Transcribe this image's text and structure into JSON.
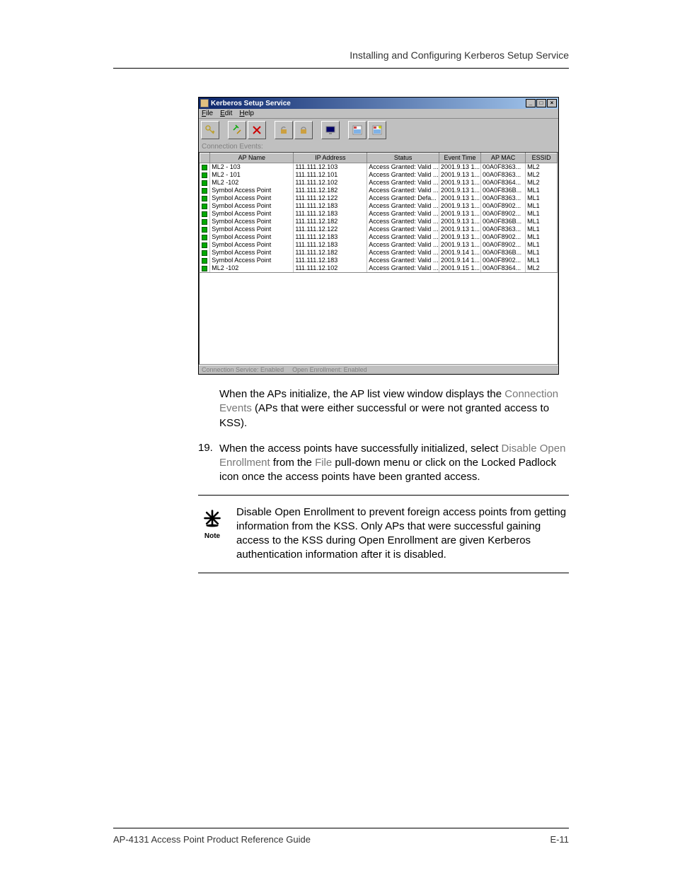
{
  "header": {
    "title": "Installing and Configuring Kerberos Setup Service"
  },
  "window": {
    "title": "Kerberos Setup Service",
    "menus": [
      "File",
      "Edit",
      "Help"
    ],
    "section_label": "Connection Events:",
    "columns": [
      "",
      "AP Name",
      "IP Address",
      "Status",
      "Event Time",
      "AP MAC",
      "ESSID"
    ],
    "rows": [
      {
        "ap": "ML2 - 103",
        "ip": "111.111.12.103",
        "status": "Access Granted: Valid ...",
        "time": "2001.9.13 1...",
        "mac": "00A0F8363...",
        "essid": "ML2"
      },
      {
        "ap": "ML2 - 101",
        "ip": "111.111.12.101",
        "status": "Access Granted: Valid ...",
        "time": "2001.9.13 1...",
        "mac": "00A0F8363...",
        "essid": "ML2"
      },
      {
        "ap": "ML2 -102",
        "ip": "111.111.12.102",
        "status": "Access Granted: Valid ...",
        "time": "2001.9.13 1...",
        "mac": "00A0F8364...",
        "essid": "ML2"
      },
      {
        "ap": "Symbol Access Point",
        "ip": "111.111.12.182",
        "status": "Access Granted: Valid ...",
        "time": "2001.9.13 1...",
        "mac": "00A0F836B...",
        "essid": "ML1"
      },
      {
        "ap": "Symbol Access Point",
        "ip": "111.111.12.122",
        "status": "Access Granted: Defa...",
        "time": "2001.9.13 1...",
        "mac": "00A0F8363...",
        "essid": "ML1"
      },
      {
        "ap": "Symbol Access Point",
        "ip": "111.111.12.183",
        "status": "Access Granted: Valid ...",
        "time": "2001.9.13 1...",
        "mac": "00A0F8902...",
        "essid": "ML1"
      },
      {
        "ap": "Symbol Access Point",
        "ip": "111.111.12.183",
        "status": "Access Granted: Valid ...",
        "time": "2001.9.13 1...",
        "mac": "00A0F8902...",
        "essid": "ML1"
      },
      {
        "ap": "Symbol Access Point",
        "ip": "111.111.12.182",
        "status": "Access Granted: Valid ...",
        "time": "2001.9.13 1...",
        "mac": "00A0F836B...",
        "essid": "ML1"
      },
      {
        "ap": "Symbol Access Point",
        "ip": "111.111.12.122",
        "status": "Access Granted: Valid ...",
        "time": "2001.9.13 1...",
        "mac": "00A0F8363...",
        "essid": "ML1"
      },
      {
        "ap": "Symbol Access Point",
        "ip": "111.111.12.183",
        "status": "Access Granted: Valid ...",
        "time": "2001.9.13 1...",
        "mac": "00A0F8902...",
        "essid": "ML1"
      },
      {
        "ap": "Symbol Access Point",
        "ip": "111.111.12.183",
        "status": "Access Granted: Valid ...",
        "time": "2001.9.13 1...",
        "mac": "00A0F8902...",
        "essid": "ML1"
      },
      {
        "ap": "Symbol Access Point",
        "ip": "111.111.12.182",
        "status": "Access Granted: Valid ...",
        "time": "2001.9.14 1...",
        "mac": "00A0F836B...",
        "essid": "ML1"
      },
      {
        "ap": "Symbol Access Point",
        "ip": "111.111.12.183",
        "status": "Access Granted: Valid ...",
        "time": "2001.9.14 1...",
        "mac": "00A0F8902...",
        "essid": "ML1"
      },
      {
        "ap": "ML2 -102",
        "ip": "111.111.12.102",
        "status": "Access Granted: Valid ...",
        "time": "2001.9.15 1...",
        "mac": "00A0F8364...",
        "essid": "ML2"
      }
    ],
    "status_left": "Connection Service: Enabled",
    "status_right": "Open Enrollment: Enabled"
  },
  "para1": {
    "pre": "When the APs initialize, the AP list view window displays the ",
    "term": "Connection Events",
    "post": " (APs that were either successful or were not granted access to KSS)."
  },
  "step19": {
    "num": "19.",
    "pre": "When the access points have successfully initialized, select ",
    "term1": "Disable Open Enrollment",
    "mid": " from the ",
    "term2": "File",
    "post": " pull-down menu or click on the Locked Padlock icon once the access points have been granted access."
  },
  "note": {
    "label": "Note",
    "text": "Disable Open Enrollment to prevent foreign access points from getting information from the KSS. Only APs that were successful gaining access to the KSS during Open Enrollment are given Kerberos authentication information after it is disabled."
  },
  "footer": {
    "left": "AP-4131 Access Point Product Reference Guide",
    "right": "E-11"
  }
}
